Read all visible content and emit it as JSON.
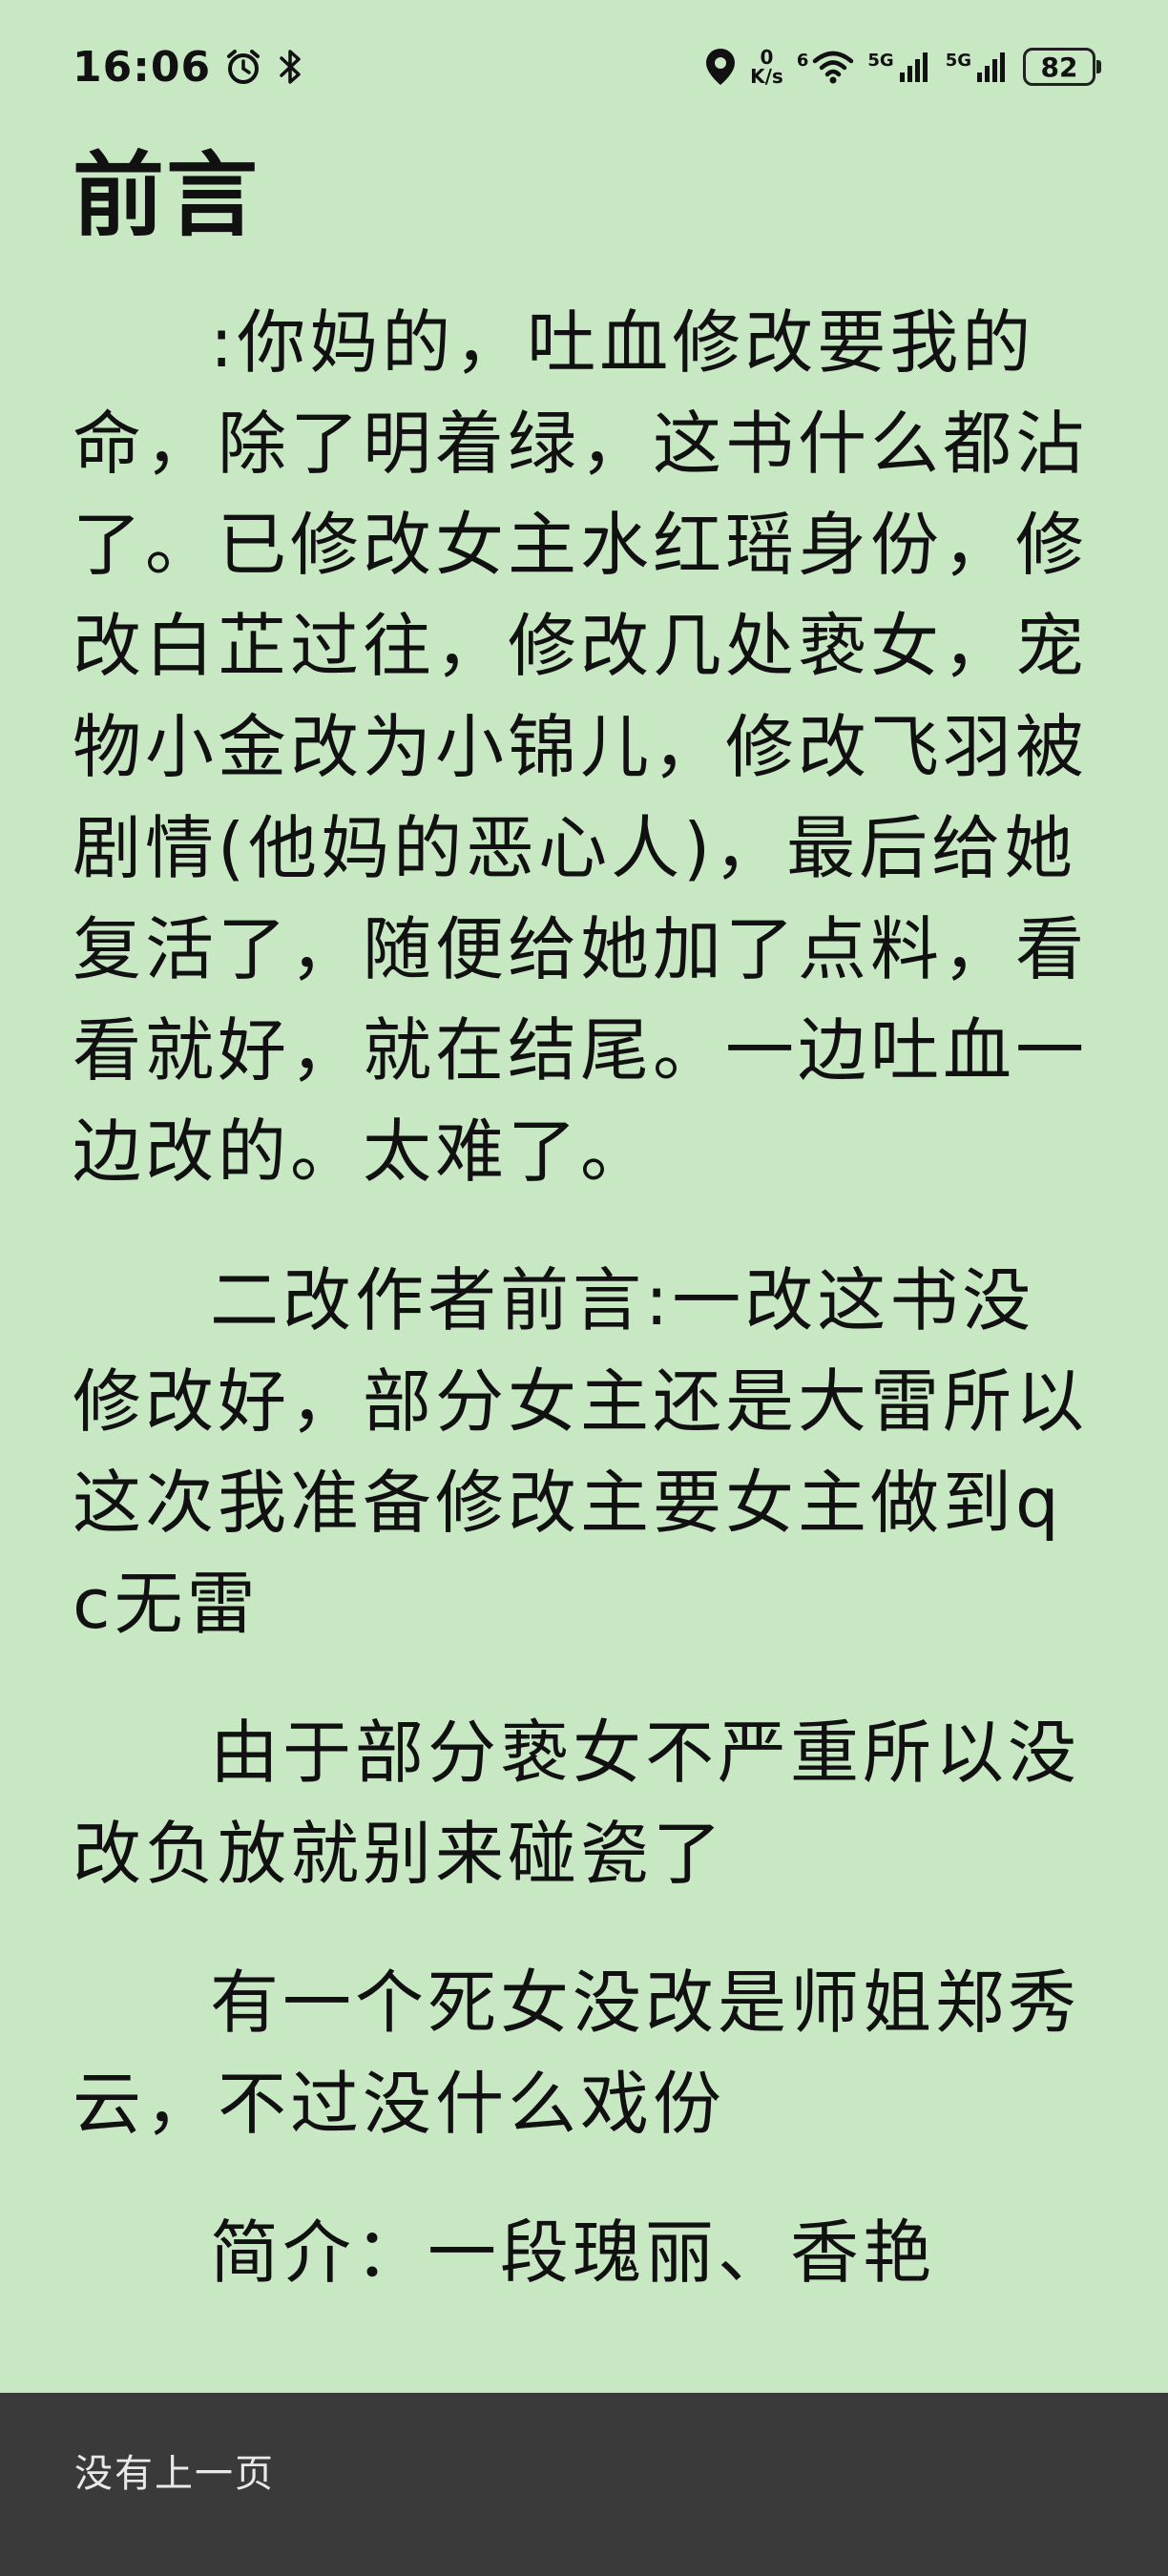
{
  "status_bar": {
    "time": "16:06",
    "speed_value": "0",
    "speed_unit": "K/s",
    "wifi_label": "6",
    "sim1_label": "5G",
    "sim2_label": "5G",
    "battery": "82"
  },
  "chapter": {
    "title": "前言",
    "paragraphs": [
      ":你妈的，吐血修改要我的命，除了明着绿，这书什么都沾了。已修改女主水红瑶身份，修改白芷过往，修改几处亵女，宠物小金改为小锦儿，修改飞羽被剧情(他妈的恶心人)，最后给她复活了，随便给她加了点料，看看就好，就在结尾。一边吐血一边改的。太难了。",
      "二改作者前言:一改这书没修改好，部分女主还是大雷所以这次我准备修改主要女主做到qc无雷",
      "由于部分亵女不严重所以没改负放就别来碰瓷了",
      "有一个死女没改是师姐郑秀云，不过没什么戏份",
      "简介：一段瑰丽、香艳"
    ]
  },
  "bottom_bar": {
    "message": "没有上一页"
  }
}
